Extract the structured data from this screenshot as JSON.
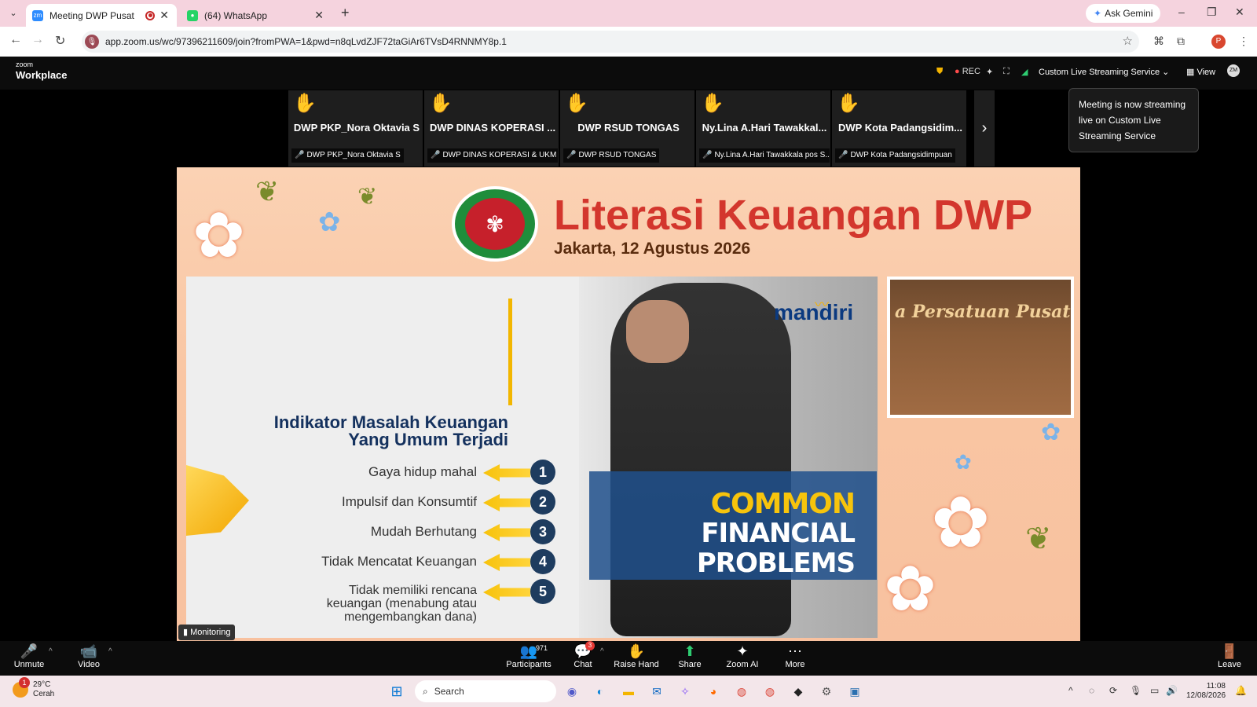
{
  "browser": {
    "tabs": [
      {
        "label": "Meeting DWP Pusat",
        "active": true
      },
      {
        "label": "(64) WhatsApp",
        "active": false
      }
    ],
    "ask_gemini": "Ask Gemini",
    "url": "app.zoom.us/wc/97396211609/join?fromPWA=1&pwd=n8qLvdZJF72taGiAr6TVsD4RNNMY8p.1",
    "profile_initial": "P"
  },
  "zoom": {
    "logo_small": "zoom",
    "logo_big": "Workplace",
    "rec_label": "REC",
    "stream_label": "Custom Live Streaming Service",
    "view_label": "View",
    "avatar": "ZM",
    "tooltip": "Meeting is now streaming live on Custom Live Streaming Service",
    "participants": [
      {
        "name": "DWP PKP_Nora Oktavia S",
        "label": "DWP PKP_Nora Oktavia S"
      },
      {
        "name": "DWP DINAS KOPERASI ...",
        "label": "DWP DINAS KOPERASI & UKM ..."
      },
      {
        "name": "DWP RSUD TONGAS",
        "label": "DWP RSUD TONGAS"
      },
      {
        "name": "Ny.Lina A.Hari Tawakkal...",
        "label": "Ny.Lina A.Hari Tawakkala pos S..."
      },
      {
        "name": "DWP Kota Padangsidim...",
        "label": "DWP Kota Padangsidimpuan"
      }
    ],
    "monitoring": "Monitoring",
    "controls": {
      "unmute": "Unmute",
      "video": "Video",
      "participants": "Participants",
      "participant_count": "971",
      "chat": "Chat",
      "chat_badge": "3",
      "raise_hand": "Raise Hand",
      "share": "Share",
      "zoom_ai": "Zoom AI",
      "more": "More",
      "leave": "Leave"
    }
  },
  "slide": {
    "title": "Literasi Keuangan DWP",
    "date": "Jakarta, 12 Agustus 2026",
    "brand": "mandiri",
    "heading": [
      "Indikator Masalah Keuangan",
      "Yang Umum Terjadi"
    ],
    "items": [
      {
        "num": "1",
        "text": "Gaya hidup mahal"
      },
      {
        "num": "2",
        "text": "Impulsif dan Konsumtif"
      },
      {
        "num": "3",
        "text": "Mudah Berhutang"
      },
      {
        "num": "4",
        "text": "Tidak Mencatat Keuangan"
      },
      {
        "num": "5",
        "text": "Tidak memiliki rencana keuangan (menabung atau mengembangkan dana)"
      }
    ],
    "banner_line1": "COMMON",
    "banner_line2": "FINANCIAL PROBLEMS",
    "inset_caption": "a Persatuan Pusat"
  },
  "taskbar": {
    "temp": "29°C",
    "weather": "Cerah",
    "weather_badge": "1",
    "search": "Search",
    "time": "11:08",
    "date": "12/08/2026"
  }
}
